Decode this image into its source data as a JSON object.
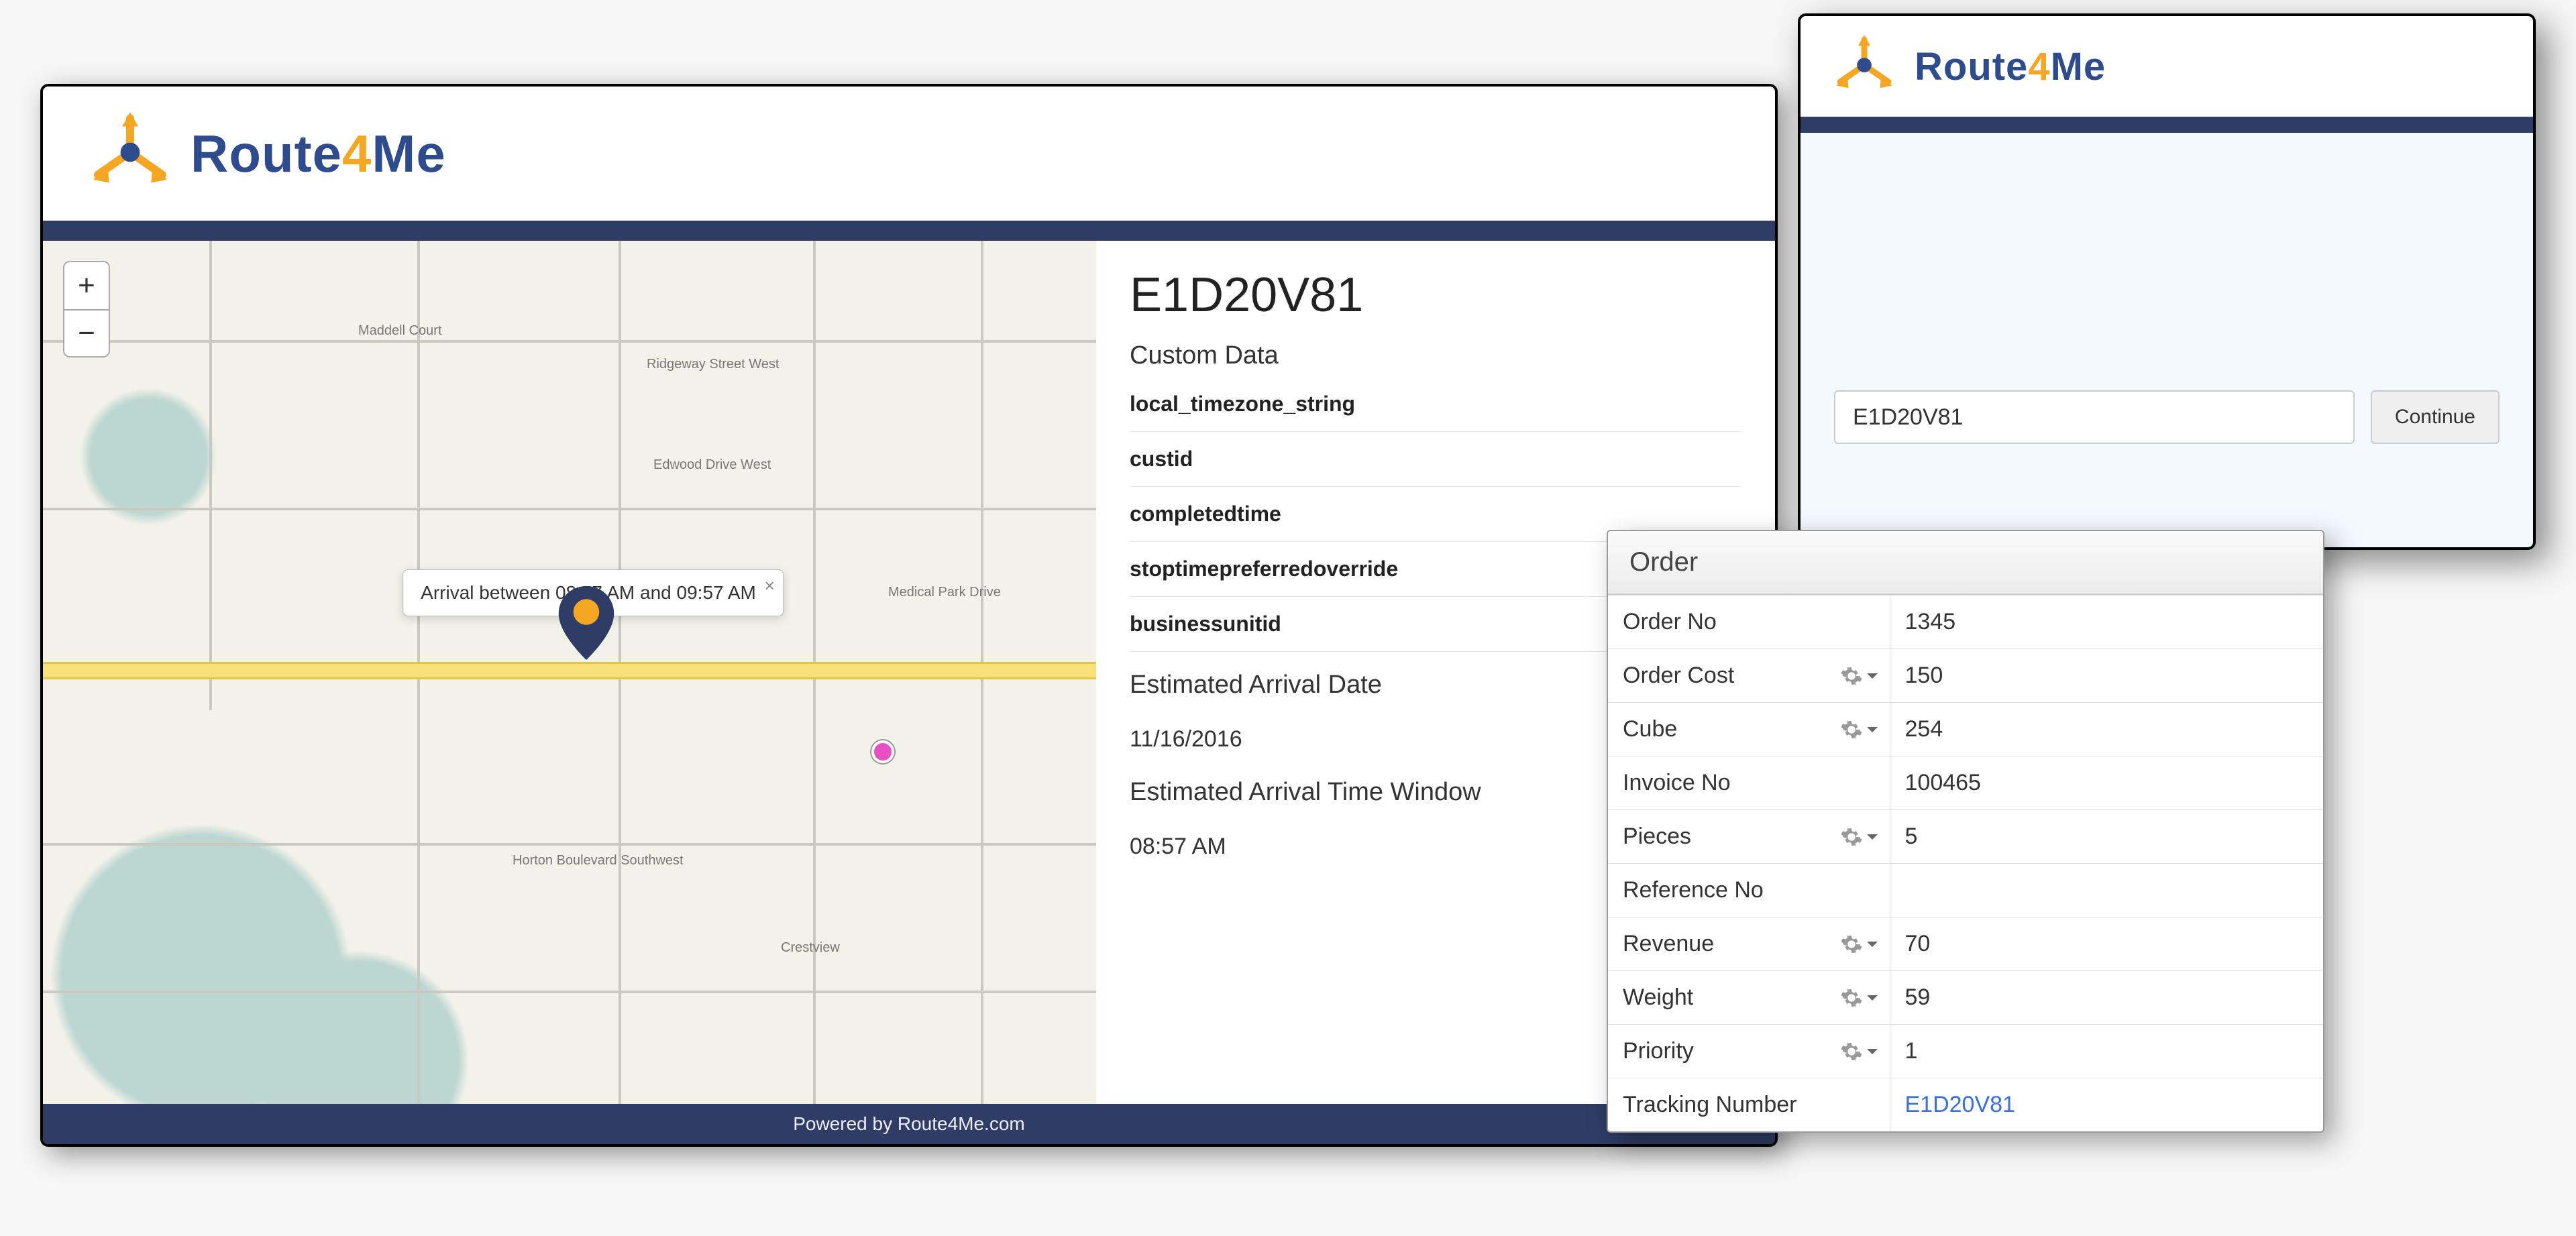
{
  "brand": {
    "name_pre": "Route",
    "name_mid": "4",
    "name_post": "Me"
  },
  "map": {
    "popup_text": "Arrival between 08:57 AM and 09:57 AM",
    "zoom_in": "+",
    "zoom_out": "−"
  },
  "detail": {
    "tracking_id": "E1D20V81",
    "custom_data_heading": "Custom Data",
    "custom_rows": [
      "local_timezone_string",
      "custid",
      "completedtime",
      "stoptimepreferredoverride",
      "businessunitid"
    ],
    "arrival_date_heading": "Estimated Arrival Date",
    "arrival_date": "11/16/2016",
    "arrival_window_heading": "Estimated Arrival Time Window",
    "arrival_window": "08:57 AM"
  },
  "footer": "Powered by Route4Me.com",
  "lookup": {
    "input_value": "E1D20V81",
    "button_label": "Continue"
  },
  "order_panel": {
    "title": "Order",
    "rows": [
      {
        "label": "Order No",
        "value": "1345",
        "gear": false,
        "link": false
      },
      {
        "label": "Order Cost",
        "value": "150",
        "gear": true,
        "link": false
      },
      {
        "label": "Cube",
        "value": "254",
        "gear": true,
        "link": false
      },
      {
        "label": "Invoice No",
        "value": "100465",
        "gear": false,
        "link": false
      },
      {
        "label": "Pieces",
        "value": "5",
        "gear": true,
        "link": false
      },
      {
        "label": "Reference No",
        "value": "",
        "gear": false,
        "link": false
      },
      {
        "label": "Revenue",
        "value": "70",
        "gear": true,
        "link": false
      },
      {
        "label": "Weight",
        "value": "59",
        "gear": true,
        "link": false
      },
      {
        "label": "Priority",
        "value": "1",
        "gear": true,
        "link": false
      },
      {
        "label": "Tracking Number",
        "value": "E1D20V81",
        "gear": false,
        "link": true
      }
    ]
  }
}
